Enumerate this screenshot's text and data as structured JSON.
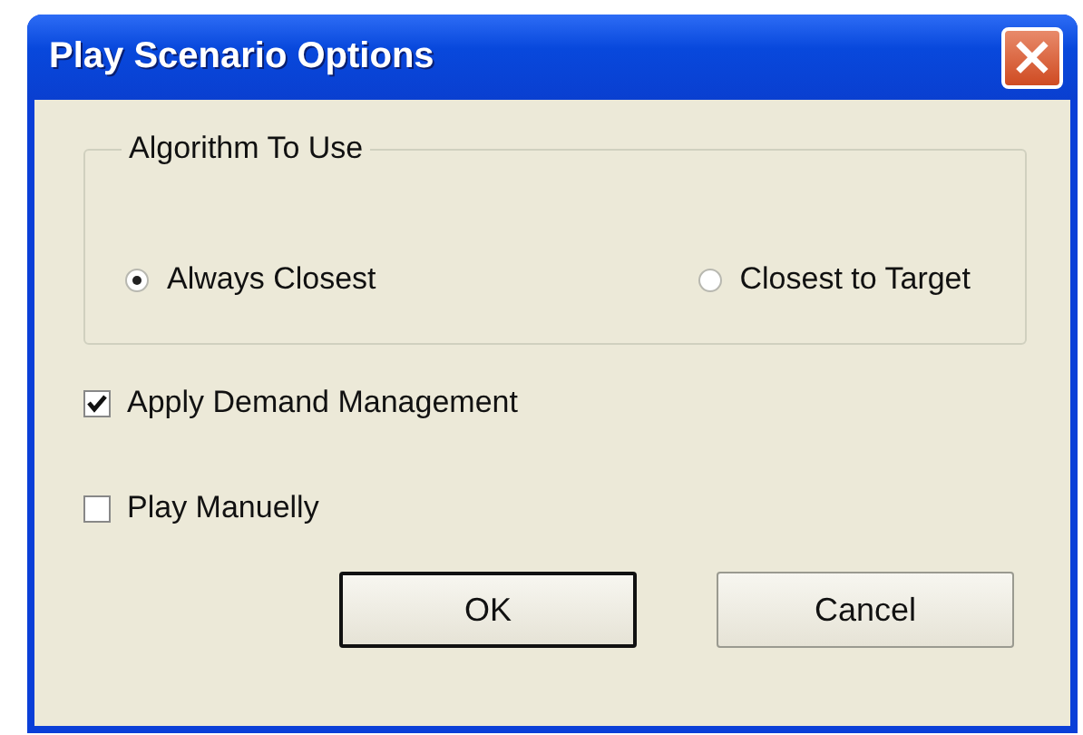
{
  "window": {
    "title": "Play Scenario Options",
    "close": "×"
  },
  "algorithm_group": {
    "label": "Algorithm To Use",
    "options": [
      {
        "label": "Always Closest",
        "selected": true
      },
      {
        "label": "Closest to Target",
        "selected": false
      }
    ]
  },
  "checkboxes": [
    {
      "label": "Apply Demand Management",
      "checked": true
    },
    {
      "label": "Play Manuelly",
      "checked": false
    }
  ],
  "buttons": [
    {
      "label": "OK",
      "default": true
    },
    {
      "label": "Cancel",
      "default": false
    }
  ]
}
